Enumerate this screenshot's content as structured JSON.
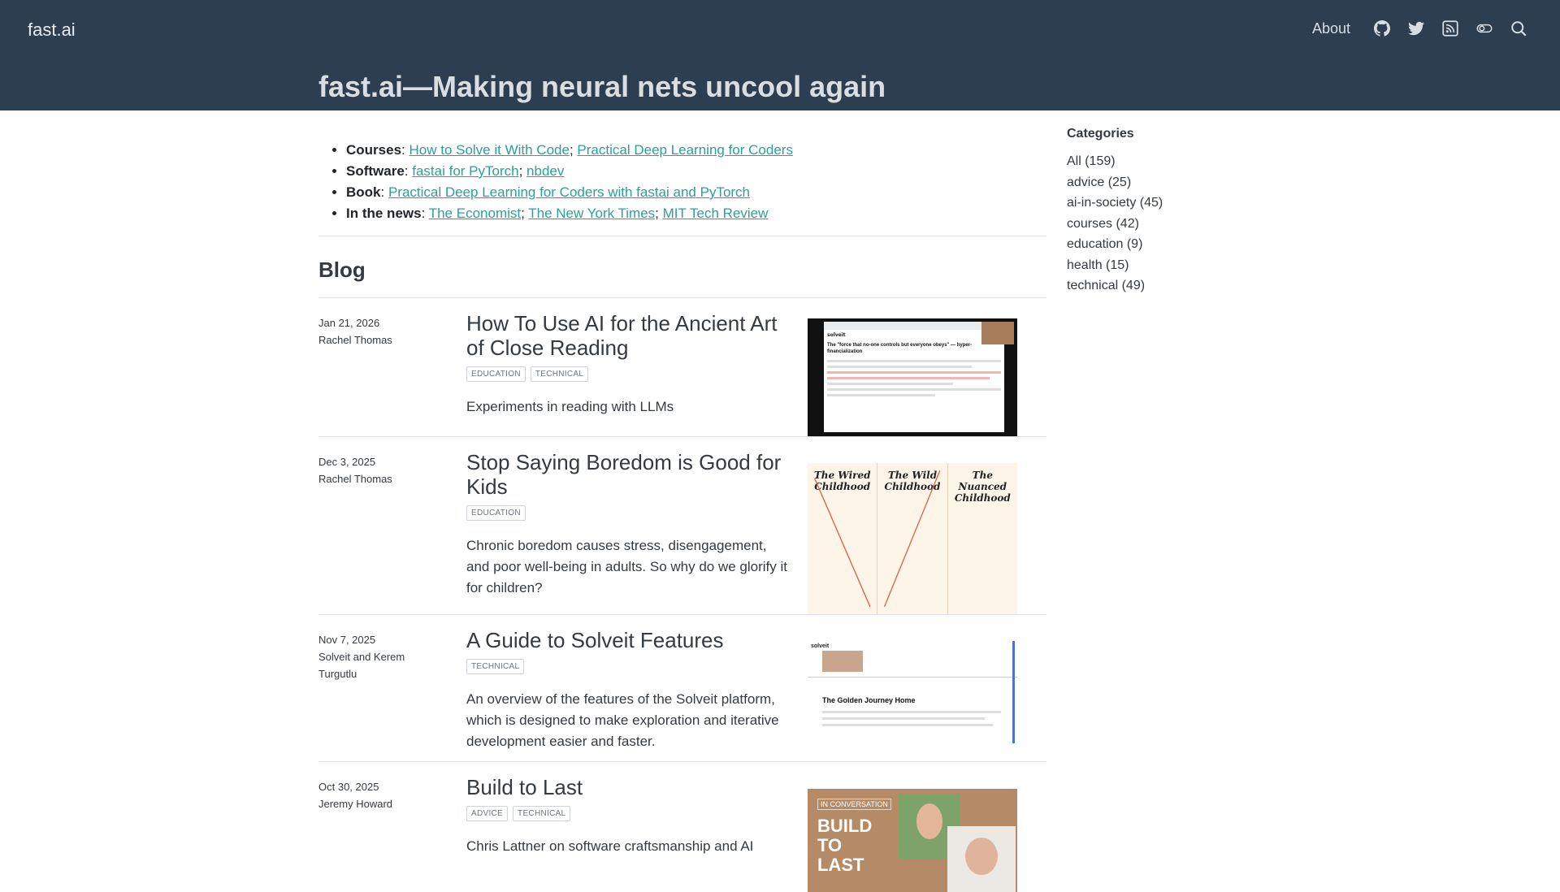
{
  "header": {
    "brand": "fast.ai",
    "about": "About",
    "title": "fast.ai—Making neural nets uncool again",
    "icons": [
      "github-icon",
      "twitter-icon",
      "rss-icon",
      "toggle-icon",
      "search-icon"
    ]
  },
  "intro": {
    "courses": {
      "label": "Courses",
      "links": [
        "How to Solve it With Code",
        "Practical Deep Learning for Coders"
      ]
    },
    "software": {
      "label": "Software",
      "links": [
        "fastai for PyTorch",
        "nbdev"
      ]
    },
    "book": {
      "label": "Book",
      "links": [
        "Practical Deep Learning for Coders with fastai and PyTorch"
      ]
    },
    "news": {
      "label": "In the news",
      "links": [
        "The Economist",
        "The New York Times",
        "MIT Tech Review"
      ]
    }
  },
  "blog": {
    "heading": "Blog",
    "posts": [
      {
        "date": "Jan 21, 2026",
        "author": "Rachel Thomas",
        "title": "How To Use AI for the Ancient Art of Close Reading",
        "categories": [
          "EDUCATION",
          "TECHNICAL"
        ],
        "description": "Experiments in reading with LLMs"
      },
      {
        "date": "Dec 3, 2025",
        "author": "Rachel Thomas",
        "title": "Stop Saying Boredom is Good for Kids",
        "categories": [
          "EDUCATION"
        ],
        "description": "Chronic boredom causes stress, disengagement, and poor well-being in adults. So why do we glorify it for children?"
      },
      {
        "date": "Nov 7, 2025",
        "author": "Solveit and Kerem Turgutlu",
        "title": "A Guide to Solveit Features",
        "categories": [
          "TECHNICAL"
        ],
        "description": "An overview of the features of the Solveit platform, which is designed to make exploration and iterative development easier and faster."
      },
      {
        "date": "Oct 30, 2025",
        "author": "Jeremy Howard",
        "title": "Build to Last",
        "categories": [
          "ADVICE",
          "TECHNICAL"
        ],
        "description": "Chris Lattner on software craftsmanship and AI"
      }
    ]
  },
  "thumbs": {
    "t1": {
      "app": "solveit",
      "heading": "The \"force that no-one controls but everyone obeys\" — hyper-financialization"
    },
    "t2": {
      "col1": "The Wired Childhood",
      "col2": "The Wild Childhood",
      "col3": "The Nuanced Childhood"
    },
    "t3": {
      "app": "solveit",
      "heading": "The Golden Journey Home"
    },
    "t4": {
      "tag": "IN CONVERSATION",
      "title": "BUILD TO LAST"
    }
  },
  "sidebar": {
    "heading": "Categories",
    "items": [
      "All (159)",
      "advice (25)",
      "ai-in-society (45)",
      "courses (42)",
      "education (9)",
      "health (15)",
      "technical (49)"
    ]
  }
}
